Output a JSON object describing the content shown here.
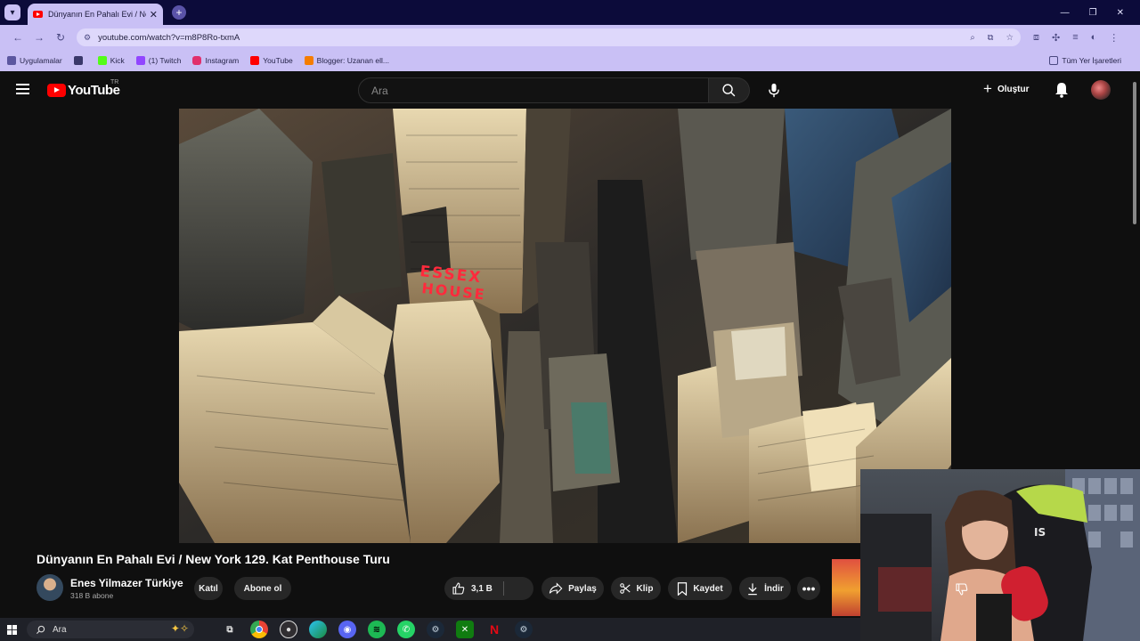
{
  "browser": {
    "tab_title": "Dünyanın En Pahalı Evi / New Y",
    "url": "youtube.com/watch?v=m8P8Ro-txmA",
    "bookmarks": [
      {
        "label": "Uygulamalar",
        "color": "#4a4880"
      },
      {
        "label": "Kick",
        "color": "#53fc18"
      },
      {
        "label": "(1) Twitch",
        "color": "#9146ff"
      },
      {
        "label": "Instagram",
        "color": "#e1306c"
      },
      {
        "label": "YouTube",
        "color": "#ff0000"
      },
      {
        "label": "Blogger: Uzanan ell...",
        "color": "#f57d00"
      }
    ],
    "all_bookmarks": "Tüm Yer İşaretleri"
  },
  "youtube": {
    "logo_text": "YouTube",
    "country_code": "TR",
    "search_placeholder": "Ara",
    "create_label": "Oluştur"
  },
  "video": {
    "title": "Dünyanın En Pahalı Evi / New York 129. Kat Penthouse Turu",
    "sign_text_1": "ESSEX",
    "sign_text_2": "HOUSE"
  },
  "channel": {
    "name": "Enes Yilmazer Türkiye",
    "subscribers": "318 B abone",
    "join_label": "Katıl",
    "subscribe_label": "Abone ol"
  },
  "actions": {
    "likes": "3,1 B",
    "share": "Paylaş",
    "clip": "Klip",
    "save": "Kaydet",
    "download": "İndir"
  },
  "taskbar": {
    "search_label": "Ara",
    "apps": [
      "task-view",
      "chrome",
      "obs",
      "edge",
      "discord",
      "spotify",
      "whatsapp",
      "steam",
      "xbox",
      "netflix",
      "steam-2"
    ]
  },
  "colors": {
    "yt_red": "#ff0000",
    "browser_frame": "#c9c0f5",
    "tab_strip": "#0c0b3a",
    "pill_bg": "#272727"
  }
}
